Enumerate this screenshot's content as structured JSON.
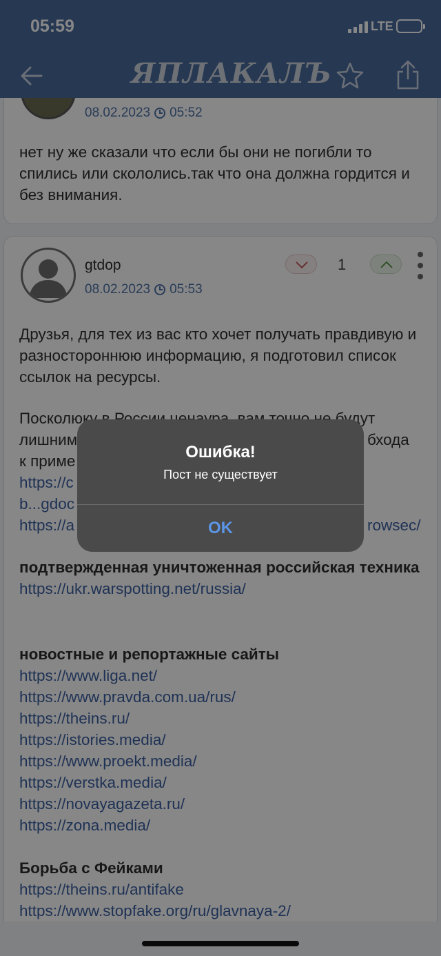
{
  "status_bar": {
    "time": "05:59",
    "network": "LTE",
    "battery_level": 1.0
  },
  "nav": {
    "logo_text": "ЯПЛАКАЛЪ",
    "back_icon": "arrow-left-icon",
    "star_icon": "star-icon",
    "share_icon": "share-icon"
  },
  "posts": [
    {
      "date": "08.02.2023",
      "time": "05:52",
      "text": "нет ну  же сказали что если бы они не погибли то спились или скололись.так что она должна гордится и без внимания."
    },
    {
      "username": "gtdop",
      "date": "08.02.2023",
      "time": "05:53",
      "score": "1",
      "intro": "Друзья, для тех из вас кто хочет получать правдивую и разностороннюю информацию, я подготовил список ссылок на ресурсы.",
      "censorship_line1": "Посколюку в России ценаура, вам точно не будут",
      "censorship_line2": "лишним",
      "censorship_line2_tail": "бхода",
      "censorship_line3": "к приме",
      "link_a": "https://c",
      "link_b": "b...gdoc",
      "link_c": "https://a",
      "link_c_tail": "rowsec/",
      "section1_title": "подтвержденная уничтоженная российская техника",
      "section1_links": [
        "https://ukr.warspotting.net/russia/"
      ],
      "section2_title": "новостные и репортажные сайты",
      "section2_links": [
        "https://www.liga.net/",
        "https://www.pravda.com.ua/rus/",
        "https://theins.ru/",
        "https://istories.media/",
        "https://www.proekt.media/",
        "https://verstka.media/",
        "https://novayagazeta.ru/",
        "https://zona.media/"
      ],
      "section3_title": "Борьба с Фейками",
      "section3_links": [
        "https://theins.ru/antifake",
        "https://www.stopfake.org/ru/glavnaya-2/"
      ]
    }
  ],
  "alert": {
    "title": "Ошибка!",
    "message": "Пост не существует",
    "ok_label": "OK"
  },
  "colors": {
    "nav_background": "#4a6b9d",
    "link": "#3b5fa0",
    "alert_button": "#5b95e6"
  }
}
